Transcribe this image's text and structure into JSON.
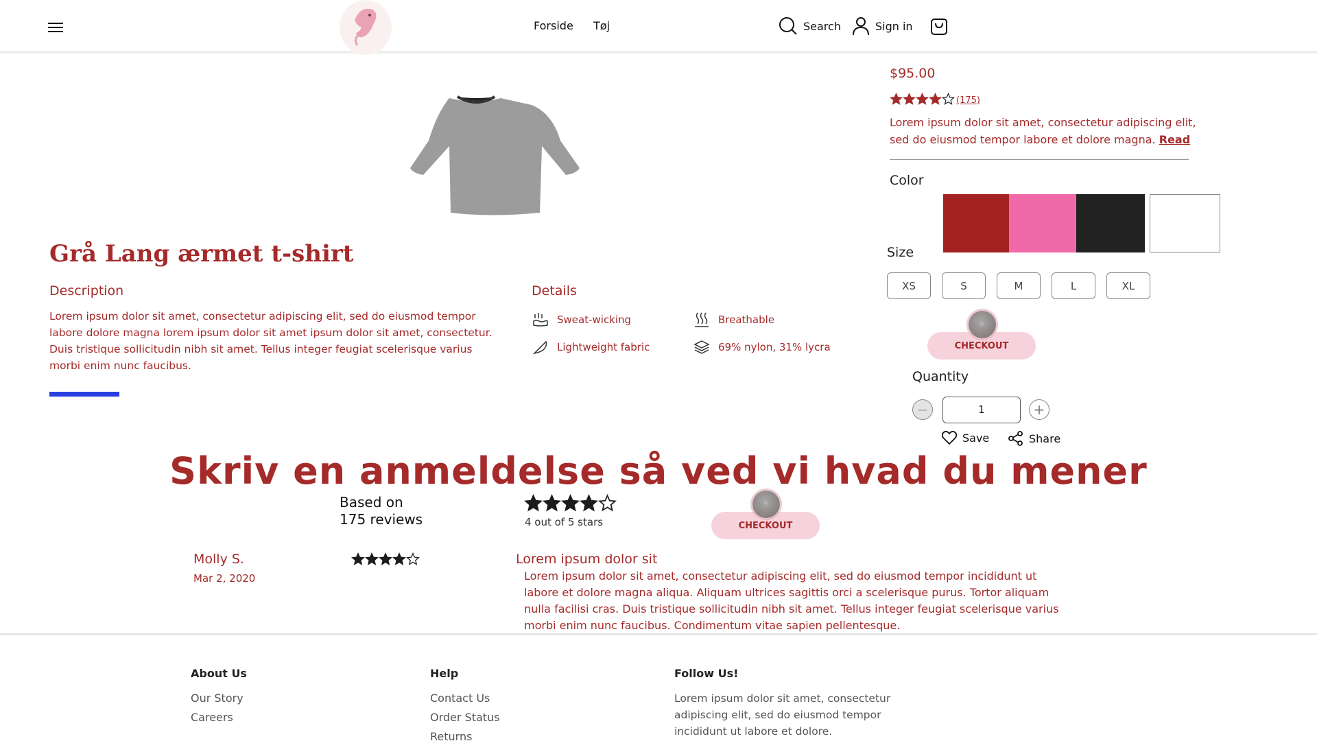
{
  "header": {
    "nav": [
      "Forside",
      "Tøj"
    ],
    "search_label": "Search",
    "signin_label": "Sign in"
  },
  "product": {
    "title": "Grå Lang ærmet t-shirt",
    "price": "$95.00",
    "rating": 4,
    "rating_max": 5,
    "review_count": "(175)",
    "blurb": "Lorem ipsum dolor sit amet, consectetur adipiscing elit, sed do eiusmod tempor labore et dolore magna.",
    "read_link": "Read",
    "description_heading": "Description",
    "description": "Lorem ipsum dolor sit amet, consectetur adipiscing elit, sed do eiusmod tempor labore dolore magna lorem ipsum dolor sit amet ipsum dolor sit amet, consectetur. Duis tristique sollicitudin nibh sit amet. Tellus integer feugiat scelerisque varius morbi enim nunc faucibus.",
    "details_heading": "Details",
    "details": [
      {
        "label": "Sweat-wicking",
        "icon": "sweat-icon"
      },
      {
        "label": "Breathable",
        "icon": "heat-waves-icon"
      },
      {
        "label": "Lightweight fabric",
        "icon": "feather-icon"
      },
      {
        "label": "69% nylon, 31% lycra",
        "icon": "layers-icon"
      }
    ]
  },
  "options": {
    "color_label": "Color",
    "colors": [
      "#a52222",
      "#f06aaa",
      "#222222",
      "#ffffff"
    ],
    "size_label": "Size",
    "sizes": [
      "XS",
      "S",
      "M",
      "L",
      "XL"
    ],
    "checkout_label": "CHECKOUT",
    "quantity_label": "Quantity",
    "quantity": "1",
    "save_label": "Save",
    "share_label": "Share"
  },
  "reviews": {
    "heading": "Skriv en anmeldelse så ved vi hvad du mener",
    "based_on_line1": "Based on",
    "based_on_line2": "175 reviews",
    "average_rating": 4,
    "out_of": "4 out of 5 stars",
    "checkout_label": "CHECKOUT",
    "items": [
      {
        "name": "Molly S.",
        "date": "Mar 2, 2020",
        "rating": 4,
        "title": "Lorem ipsum dolor sit",
        "body": "Lorem ipsum dolor sit amet, consectetur adipiscing elit, sed do eiusmod tempor incididunt ut labore et dolore magna aliqua. Aliquam ultrices sagittis orci a scelerisque purus. Tortor aliquam nulla facilisi cras. Duis tristique sollicitudin nibh sit amet. Tellus integer feugiat scelerisque varius morbi enim nunc faucibus. Condimentum vitae sapien pellentesque."
      }
    ]
  },
  "footer": {
    "about_heading": "About Us",
    "about_links": [
      "Our Story",
      "Careers"
    ],
    "help_heading": "Help",
    "help_links": [
      "Contact Us",
      "Order Status",
      "Returns"
    ],
    "follow_heading": "Follow Us!",
    "follow_text": "Lorem ipsum dolor sit amet, consectetur adipiscing elit, sed do eiusmod tempor incididunt ut labore et dolore."
  },
  "colors": {
    "accent": "#a52a2a",
    "checkout_bg": "#f6d2dc",
    "progress_blue": "#2a3fe0"
  }
}
